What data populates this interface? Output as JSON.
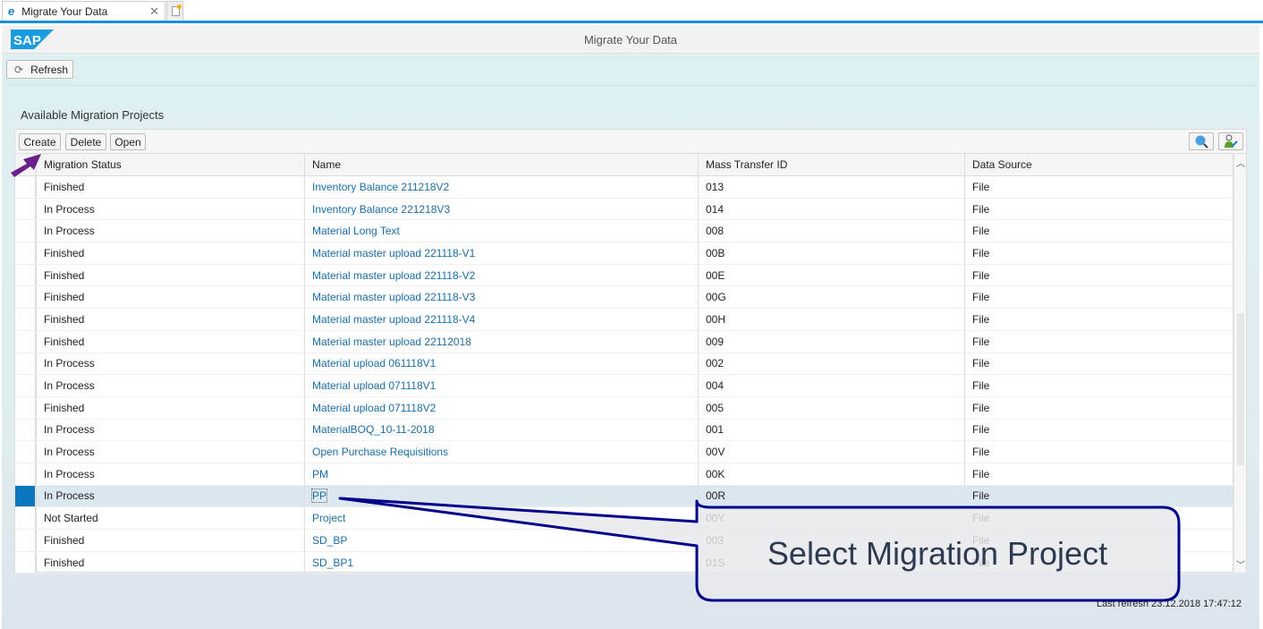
{
  "browser": {
    "tab_title": "Migrate Your Data"
  },
  "shell": {
    "logo": "SAP",
    "title": "Migrate Your Data"
  },
  "toolbar": {
    "refresh_label": "Refresh"
  },
  "section": {
    "title": "Available Migration Projects",
    "create": "Create",
    "delete": "Delete",
    "open": "Open"
  },
  "table": {
    "columns": [
      "Migration Status",
      "Name",
      "Mass Transfer ID",
      "Data Source"
    ],
    "selected_index": 14,
    "rows": [
      [
        "Finished",
        "Inventory Balance 211218V2",
        "013",
        "File"
      ],
      [
        "In Process",
        "Inventory Balance 221218V3",
        "014",
        "File"
      ],
      [
        "In Process",
        "Material Long Text",
        "008",
        "File"
      ],
      [
        "Finished",
        "Material master upload 221118-V1",
        "00B",
        "File"
      ],
      [
        "Finished",
        "Material master upload 221118-V2",
        "00E",
        "File"
      ],
      [
        "Finished",
        "Material master upload 221118-V3",
        "00G",
        "File"
      ],
      [
        "Finished",
        "Material master upload 221118-V4",
        "00H",
        "File"
      ],
      [
        "Finished",
        "Material master upload 22112018",
        "009",
        "File"
      ],
      [
        "In Process",
        "Material upload 061118V1",
        "002",
        "File"
      ],
      [
        "In Process",
        "Material upload 071118V1",
        "004",
        "File"
      ],
      [
        "Finished",
        "Material upload 071118V2",
        "005",
        "File"
      ],
      [
        "In Process",
        "MaterialBOQ_10-11-2018",
        "001",
        "File"
      ],
      [
        "In Process",
        "Open Purchase Requisitions",
        "00V",
        "File"
      ],
      [
        "In Process",
        "PM",
        "00K",
        "File"
      ],
      [
        "In Process",
        "PP",
        "00R",
        "File"
      ],
      [
        "Not Started",
        "Project",
        "00Y",
        "File"
      ],
      [
        "Finished",
        "SD_BP",
        "003",
        "File"
      ],
      [
        "Finished",
        "SD_BP1",
        "01S",
        "File"
      ]
    ]
  },
  "footer": {
    "last_refresh": "Last refresh 23.12.2018 17:47:12"
  },
  "annotation": {
    "text": "Select Migration Project",
    "border_color": "#00008b",
    "arrow_color": "#6a1f8a"
  },
  "colors": {
    "accent": "#0a77bd",
    "link": "#1a6ea8"
  }
}
